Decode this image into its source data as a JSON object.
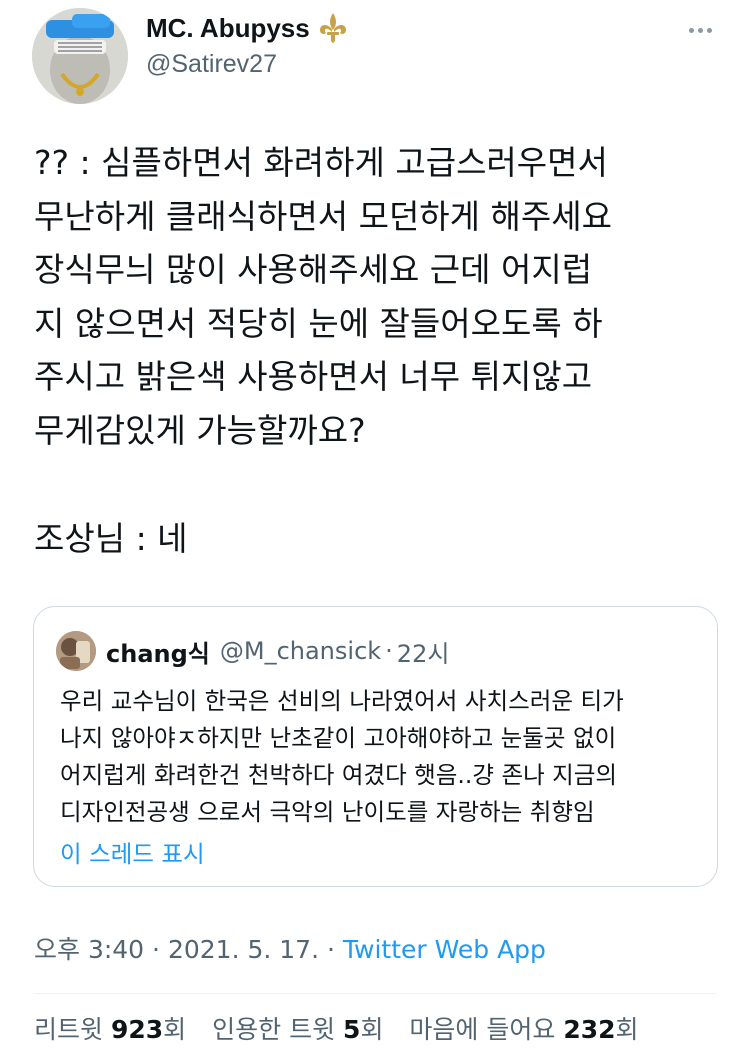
{
  "author": {
    "display_name": "MC. Abupyss",
    "handle": "@Satirev27",
    "badge_icon": "fleur-de-lis-icon"
  },
  "tweet": {
    "lines": [
      "?? : 심플하면서 화려하게 고급스러우면서",
      "무난하게 클래식하면서 모던하게 해주세요",
      "장식무늬 많이 사용해주세요 근데 어지럽",
      "지 않으면서 적당히 눈에 잘들어오도록 하",
      "주시고 밝은색 사용하면서 너무 튀지않고",
      "무게감있게 가능할까요?"
    ],
    "reply": "조상님 : 네"
  },
  "quote": {
    "display_name": "chang식",
    "handle": "@M_chansick",
    "separator": "·",
    "time": "22시",
    "lines": [
      "우리 교수님이 한국은 선비의 나라였어서 사치스러운 티가",
      "나지 않아야ㅈ하지만 난초같이 고아해야하고 눈둘곳 없이",
      "어지럽게 화려한건 천박하다 여겼다 햇음..걍 존나 지금의",
      "디자인전공생 으로서 극악의 난이도를 자랑하는 취향임"
    ],
    "show_thread": "이 스레드 표시"
  },
  "meta": {
    "time": "오후 3:40",
    "separator": "·",
    "date": "2021. 5. 17.",
    "source": "Twitter Web App"
  },
  "stats": {
    "retweets_label": "리트윗",
    "retweets_count": "923",
    "retweets_unit": "회",
    "quotes_label": "인용한 트윗",
    "quotes_count": "5",
    "quotes_unit": "회",
    "likes_label": "마음에 들어요",
    "likes_count": "232",
    "likes_unit": "회"
  },
  "colors": {
    "accent": "#1d9bf0",
    "secondary_text": "#536471",
    "badge": "#c8a24a"
  }
}
